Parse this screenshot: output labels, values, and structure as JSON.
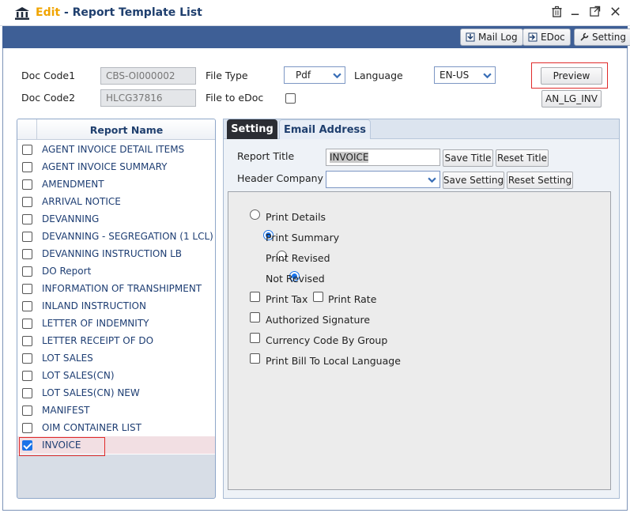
{
  "window": {
    "edit_label": "Edit",
    "separator": " - ",
    "title": "Report Template List"
  },
  "toolbar": {
    "mail_log": "Mail Log",
    "edoc": "EDoc",
    "setting": "Setting"
  },
  "form": {
    "doc_code1_label": "Doc Code1",
    "doc_code1_value": "CBS-OI000002",
    "doc_code2_label": "Doc Code2",
    "doc_code2_value": "HLCG37816",
    "file_type_label": "File Type",
    "file_type_value": "Pdf",
    "file_to_edoc_label": "File to eDoc",
    "language_label": "Language",
    "language_value": "EN-US",
    "preview_button": "Preview",
    "template_code": "AN_LG_INV"
  },
  "report_list": {
    "header": "Report Name",
    "items": [
      {
        "name": "AGENT INVOICE DETAIL ITEMS",
        "checked": false
      },
      {
        "name": "AGENT INVOICE SUMMARY",
        "checked": false
      },
      {
        "name": "AMENDMENT",
        "checked": false
      },
      {
        "name": "ARRIVAL NOTICE",
        "checked": false
      },
      {
        "name": "DEVANNING",
        "checked": false
      },
      {
        "name": "DEVANNING - SEGREGATION (1 LCL)",
        "checked": false
      },
      {
        "name": "DEVANNING INSTRUCTION LB",
        "checked": false
      },
      {
        "name": "DO Report",
        "checked": false
      },
      {
        "name": "INFORMATION OF TRANSHIPMENT",
        "checked": false
      },
      {
        "name": "INLAND INSTRUCTION",
        "checked": false
      },
      {
        "name": "LETTER OF INDEMNITY",
        "checked": false
      },
      {
        "name": "LETTER RECEIPT OF DO",
        "checked": false
      },
      {
        "name": "LOT SALES",
        "checked": false
      },
      {
        "name": "LOT SALES(CN)",
        "checked": false
      },
      {
        "name": "LOT SALES(CN) NEW",
        "checked": false
      },
      {
        "name": "MANIFEST",
        "checked": false
      },
      {
        "name": "OIM CONTAINER LIST",
        "checked": false
      },
      {
        "name": "INVOICE",
        "checked": true
      }
    ]
  },
  "tabs": {
    "setting": "Setting",
    "email": "Email Address"
  },
  "setting": {
    "report_title_label": "Report Title",
    "report_title_value": "INVOICE",
    "save_title": "Save Title",
    "reset_title": "Reset Title",
    "header_company_label": "Header Company",
    "header_company_value": "",
    "save_setting": "Save Setting",
    "reset_setting": "Reset Setting",
    "options": {
      "print_details": "Print Details",
      "print_summary": "Print Summary",
      "print_revised": "Print Revised",
      "not_revised": "Not Revised",
      "print_tax": "Print Tax",
      "print_rate": "Print Rate",
      "authorized_signature": "Authorized Signature",
      "currency_code_by_group": "Currency Code By Group",
      "print_bill_local_language": "Print Bill To Local Language"
    }
  },
  "colors": {
    "toolbar_bg": "#3e5f96",
    "title_text": "#1f3f6e",
    "edit_accent": "#f0a400",
    "highlight_box": "#e02b2b",
    "checkbox_checked": "#1a73e8"
  }
}
